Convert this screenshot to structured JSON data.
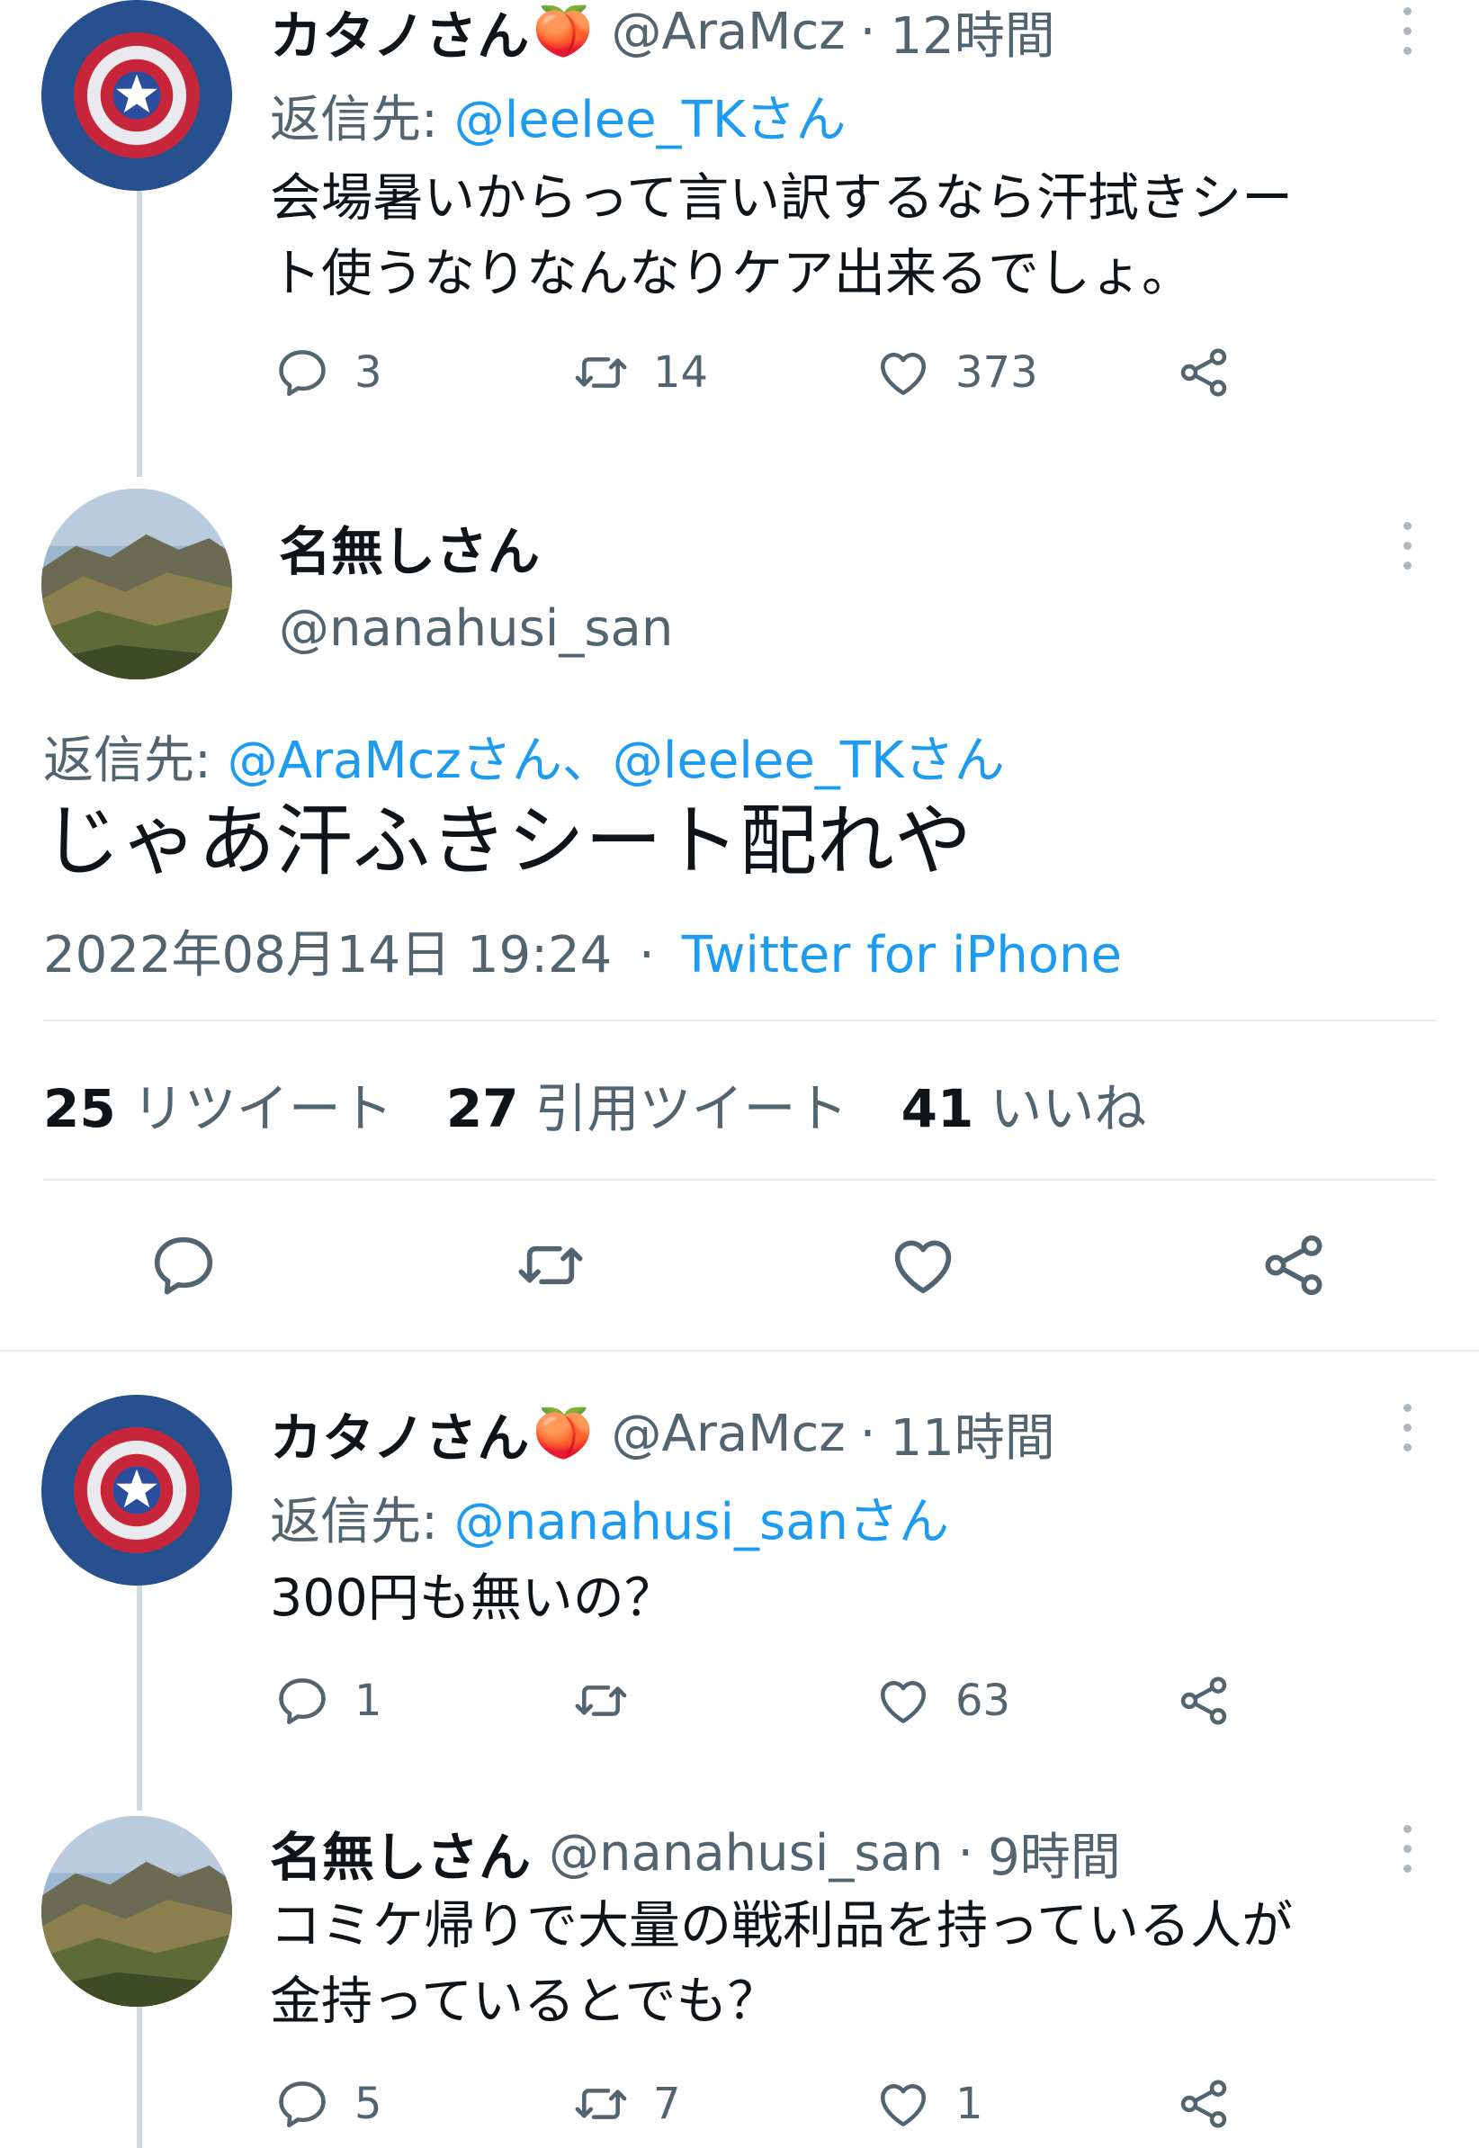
{
  "tweet1": {
    "name": "カタノさん",
    "emoji": "🍑",
    "handle": "@AraMcz",
    "time": "12時間",
    "reply_prefix": "返信先:",
    "reply_to": "@leelee_TKさん",
    "text_line1": "会場暑いからって言い訳するなら汗拭きシー",
    "text_line2": "ト使うなりなんなりケア出来るでしょ。",
    "replies": "3",
    "retweets": "14",
    "likes": "373"
  },
  "main_tweet": {
    "name": "名無しさん",
    "handle": "@nanahusi_san",
    "reply_prefix": "返信先:",
    "reply_to_1": "@AraMczさん",
    "reply_sep": "、",
    "reply_to_2": "@leelee_TKさん",
    "text": "じゃあ汗ふきシート配れや",
    "date": "2022年08月14日 19:24",
    "sep": "·",
    "source": "Twitter for iPhone",
    "retweet_count": "25",
    "retweet_label": "リツイート",
    "quote_count": "27",
    "quote_label": "引用ツイート",
    "like_count": "41",
    "like_label": "いいね"
  },
  "tweet3": {
    "name": "カタノさん",
    "emoji": "🍑",
    "handle": "@AraMcz",
    "time": "11時間",
    "reply_prefix": "返信先:",
    "reply_to": "@nanahusi_sanさん",
    "text": "300円も無いの？",
    "replies": "1",
    "retweets": "",
    "likes": "63"
  },
  "tweet4": {
    "name": "名無しさん",
    "handle": "@nanahusi_san",
    "time": "9時間",
    "text_line1": "コミケ帰りで大量の戦利品を持っている人が",
    "text_line2": "金持っているとでも？",
    "replies": "5",
    "retweets": "7",
    "likes": "1"
  },
  "meta_sep": "·",
  "colors": {
    "link": "#1d9bf0",
    "secondary": "#536471",
    "thread_line": "#cfd9de"
  },
  "icons": [
    "reply-icon",
    "retweet-icon",
    "like-icon",
    "share-icon",
    "more-icon"
  ]
}
